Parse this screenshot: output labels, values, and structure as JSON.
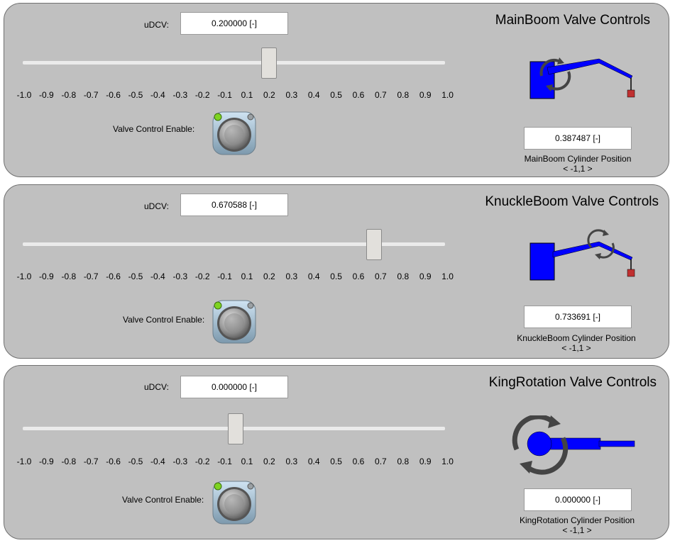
{
  "panels": [
    {
      "title": "MainBoom Valve Controls",
      "udcv_label": "uDCV:",
      "udcv_value": "0.200000 [-]",
      "slider_value": 0.2,
      "enable_label": "Valve Control Enable:",
      "enabled_led": true,
      "cylinder_value": "0.387487 [-]",
      "cylinder_label": "MainBoom Cylinder Position",
      "range_label": "< -1,1 >",
      "icon": "main-boom-icon"
    },
    {
      "title": "KnuckleBoom Valve Controls",
      "udcv_label": "uDCV:",
      "udcv_value": "0.670588 [-]",
      "slider_value": 0.670588,
      "enable_label": "Valve Control Enable:",
      "enabled_led": true,
      "cylinder_value": "0.733691 [-]",
      "cylinder_label": "KnuckleBoom Cylinder Position",
      "range_label": "< -1,1 >",
      "icon": "knuckle-boom-icon"
    },
    {
      "title": "KingRotation Valve Controls",
      "udcv_label": "uDCV:",
      "udcv_value": "0.000000 [-]",
      "slider_value": 0.0,
      "enable_label": "Valve Control Enable:",
      "enabled_led": true,
      "cylinder_value": "0.000000 [-]",
      "cylinder_label": "KingRotation Cylinder Position",
      "range_label": "< -1,1 >",
      "icon": "king-rotation-icon"
    }
  ],
  "ticks": [
    "-1.0",
    "-0.9",
    "-0.8",
    "-0.7",
    "-0.6",
    "-0.5",
    "-0.4",
    "-0.3",
    "-0.2",
    "-0.1",
    "0.1",
    "0.2",
    "0.3",
    "0.4",
    "0.5",
    "0.6",
    "0.7",
    "0.8",
    "0.9",
    "1.0"
  ],
  "colors": {
    "panel_bg": "#c0c0c0",
    "boom_blue": "#0000ff",
    "hook_red": "#c03030",
    "led_green": "#7ed321"
  }
}
